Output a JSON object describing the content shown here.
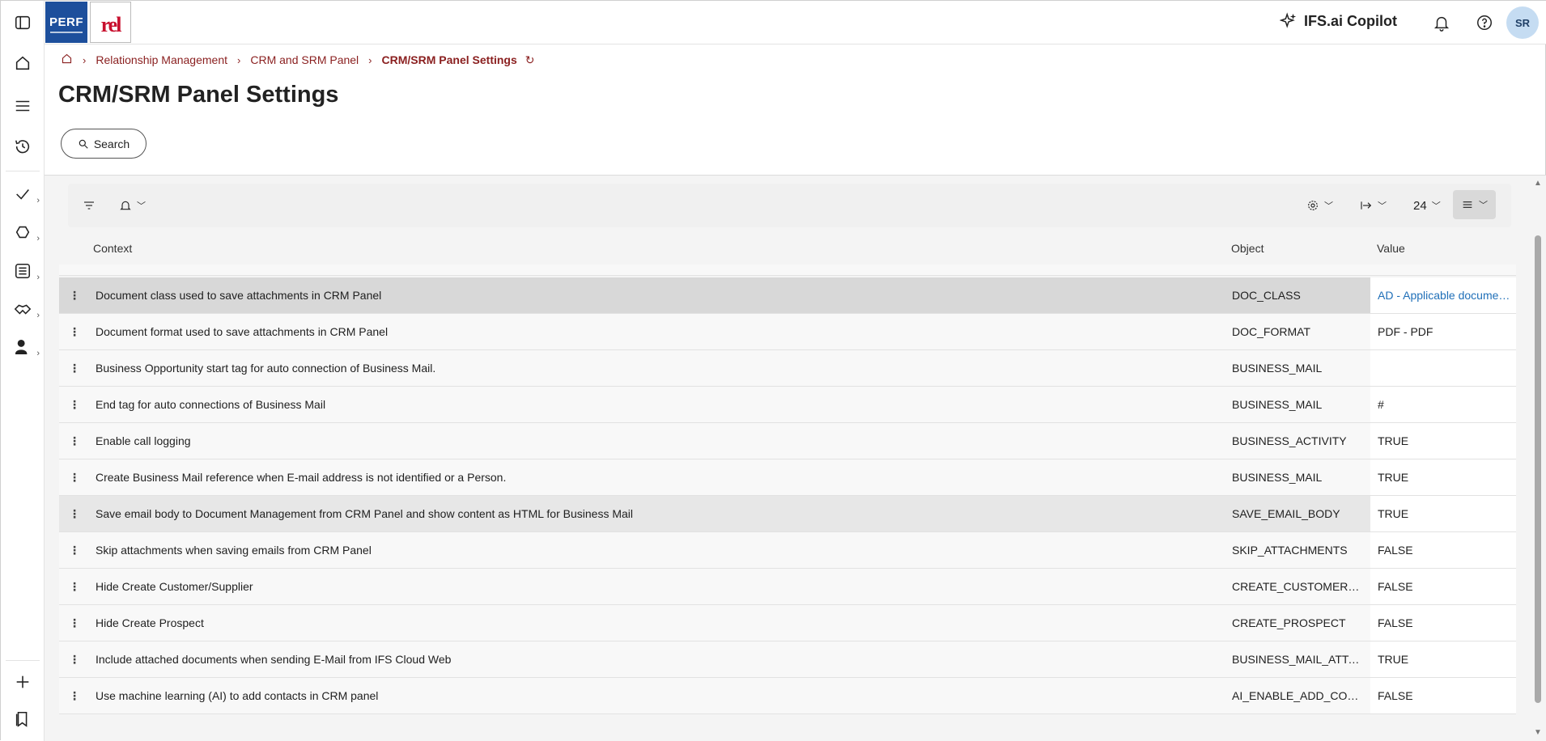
{
  "topbar": {
    "logo_perf": "PERF",
    "logo_rel": "rel",
    "copilot_label": "IFS.ai Copilot",
    "avatar_initials": "SR"
  },
  "breadcrumb": {
    "items": [
      "Relationship Management",
      "CRM and SRM Panel"
    ],
    "current": "CRM/SRM Panel Settings"
  },
  "page": {
    "title": "CRM/SRM Panel Settings",
    "search_label": "Search"
  },
  "toolbar": {
    "page_size": "24"
  },
  "table": {
    "headers": {
      "context": "Context",
      "object": "Object",
      "value": "Value"
    },
    "rows": [
      {
        "context": "Document class used to save attachments in CRM Panel",
        "object": "DOC_CLASS",
        "value": "AD - Applicable documents"
      },
      {
        "context": "Document format used to save attachments in CRM Panel",
        "object": "DOC_FORMAT",
        "value": "PDF - PDF"
      },
      {
        "context": "Business Opportunity start tag for auto connection of Business Mail.",
        "object": "BUSINESS_MAIL",
        "value": ""
      },
      {
        "context": "End tag for auto connections of Business Mail",
        "object": "BUSINESS_MAIL",
        "value": "#"
      },
      {
        "context": "Enable call logging",
        "object": "BUSINESS_ACTIVITY",
        "value": "TRUE"
      },
      {
        "context": "Create Business Mail reference when E-mail address is not identified or a Person.",
        "object": "BUSINESS_MAIL",
        "value": "TRUE"
      },
      {
        "context": "Save email body to Document Management from CRM Panel and show content as HTML for Business Mail",
        "object": "SAVE_EMAIL_BODY",
        "value": "TRUE"
      },
      {
        "context": "Skip attachments when saving emails from CRM Panel",
        "object": "SKIP_ATTACHMENTS",
        "value": "FALSE"
      },
      {
        "context": "Hide Create Customer/Supplier",
        "object": "CREATE_CUSTOMER_OR_SUPPLIER",
        "value": "FALSE"
      },
      {
        "context": "Hide Create Prospect",
        "object": "CREATE_PROSPECT",
        "value": "FALSE"
      },
      {
        "context": "Include attached documents when sending E-Mail from IFS Cloud Web",
        "object": "BUSINESS_MAIL_ATTACHMENTS",
        "value": "TRUE"
      },
      {
        "context": "Use machine learning (AI) to add contacts in CRM panel",
        "object": "AI_ENABLE_ADD_CONTACTS",
        "value": "FALSE"
      }
    ]
  },
  "colors": {
    "accent_red": "#8a1f1f",
    "link_blue": "#1f6fb8",
    "avatar_bg": "#c5dcf2",
    "perf_blue": "#1d4f9c"
  }
}
